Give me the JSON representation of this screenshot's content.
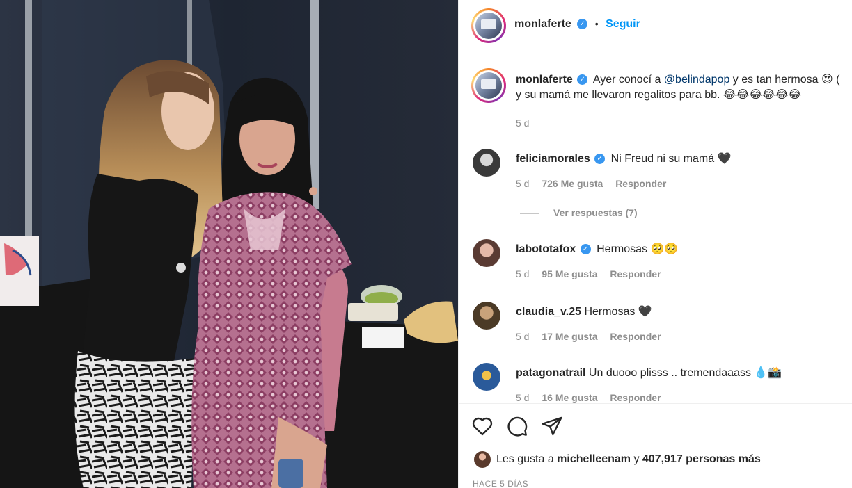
{
  "post": {
    "username": "monlaferte",
    "follow_label": "Seguir",
    "dot": "•",
    "caption_line1_pre": "Ayer conocí a ",
    "caption_mention": "@belindapop",
    "caption_line1_post": " y es tan hermosa 😍 (",
    "caption_line2": "y su mamá me llevaron regalitos para bb. 😂😂😂😂😂😂",
    "caption_age": "5 d"
  },
  "comments": [
    {
      "username": "feliciamorales",
      "verified": true,
      "text": "Ni Freud ni su mamá 🖤",
      "age": "5 d",
      "likes": "726 Me gusta",
      "reply": "Responder"
    },
    {
      "username": "labototafox",
      "verified": true,
      "text": "Hermosas 🥺🥺",
      "age": "5 d",
      "likes": "95 Me gusta",
      "reply": "Responder"
    },
    {
      "username": "claudia_v.25",
      "verified": false,
      "text": "Hermosas 🖤",
      "age": "5 d",
      "likes": "17 Me gusta",
      "reply": "Responder"
    },
    {
      "username": "patagonatrail",
      "verified": false,
      "text": "Un duooo plisss .. tremendaaass 💧📸",
      "age": "5 d",
      "likes": "16 Me gusta",
      "reply": "Responder"
    }
  ],
  "view_replies": "Ver respuestas (7)",
  "footer": {
    "likes_prefix": "Les gusta a ",
    "likes_user": "michelleenam",
    "likes_mid": " y ",
    "likes_count": "407,917 personas más",
    "date": "HACE 5 DÍAS"
  },
  "icons": [
    "verified-icon",
    "heart-icon",
    "comment-icon",
    "share-icon"
  ],
  "colors": {
    "accent": "#0095f6",
    "verified": "#3897f0",
    "muted": "#8e8e8e",
    "text": "#262626"
  }
}
